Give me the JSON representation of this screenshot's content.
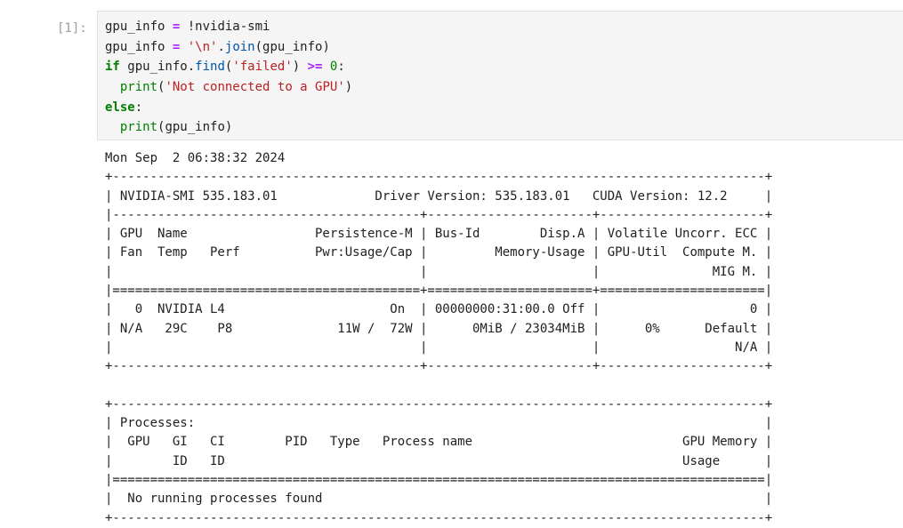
{
  "cell": {
    "prompt": "[1]:",
    "code_lines": [
      [
        {
          "t": "gpu_info ",
          "c": ""
        },
        {
          "t": "=",
          "c": "op"
        },
        {
          "t": " !nvidia-smi",
          "c": ""
        }
      ],
      [
        {
          "t": "gpu_info ",
          "c": ""
        },
        {
          "t": "=",
          "c": "op"
        },
        {
          "t": " ",
          "c": ""
        },
        {
          "t": "'\\n'",
          "c": "str"
        },
        {
          "t": ".",
          "c": ""
        },
        {
          "t": "join",
          "c": "attr"
        },
        {
          "t": "(gpu_info)",
          "c": ""
        }
      ],
      [
        {
          "t": "if",
          "c": "kw"
        },
        {
          "t": " gpu_info.",
          "c": ""
        },
        {
          "t": "find",
          "c": "attr"
        },
        {
          "t": "(",
          "c": ""
        },
        {
          "t": "'failed'",
          "c": "str"
        },
        {
          "t": ") ",
          "c": ""
        },
        {
          "t": ">=",
          "c": "op"
        },
        {
          "t": " ",
          "c": ""
        },
        {
          "t": "0",
          "c": "num"
        },
        {
          "t": ":",
          "c": ""
        }
      ],
      [
        {
          "t": "  ",
          "c": ""
        },
        {
          "t": "print",
          "c": "num"
        },
        {
          "t": "(",
          "c": ""
        },
        {
          "t": "'Not connected to a GPU'",
          "c": "str"
        },
        {
          "t": ")",
          "c": ""
        }
      ],
      [
        {
          "t": "else",
          "c": "kw"
        },
        {
          "t": ":",
          "c": ""
        }
      ],
      [
        {
          "t": "  ",
          "c": ""
        },
        {
          "t": "print",
          "c": "num"
        },
        {
          "t": "(gpu_info)",
          "c": ""
        }
      ]
    ]
  },
  "output_lines": [
    "Mon Sep  2 06:38:32 2024",
    "+---------------------------------------------------------------------------------------+",
    "| NVIDIA-SMI 535.183.01             Driver Version: 535.183.01   CUDA Version: 12.2     |",
    "|-----------------------------------------+----------------------+----------------------+",
    "| GPU  Name                 Persistence-M | Bus-Id        Disp.A | Volatile Uncorr. ECC |",
    "| Fan  Temp   Perf          Pwr:Usage/Cap |         Memory-Usage | GPU-Util  Compute M. |",
    "|                                         |                      |               MIG M. |",
    "|=========================================+======================+======================|",
    "|   0  NVIDIA L4                      On  | 00000000:31:00.0 Off |                    0 |",
    "| N/A   29C    P8              11W /  72W |      0MiB / 23034MiB |      0%      Default |",
    "|                                         |                      |                  N/A |",
    "+-----------------------------------------+----------------------+----------------------+",
    "",
    "+---------------------------------------------------------------------------------------+",
    "| Processes:                                                                            |",
    "|  GPU   GI   CI        PID   Type   Process name                            GPU Memory |",
    "|        ID   ID                                                             Usage      |",
    "|=======================================================================================|",
    "|  No running processes found                                                           |",
    "+---------------------------------------------------------------------------------------+"
  ]
}
